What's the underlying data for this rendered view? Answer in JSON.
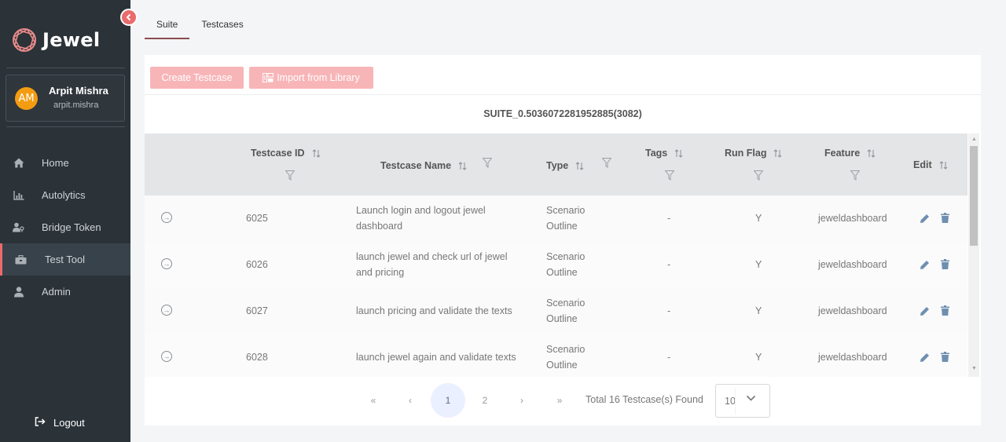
{
  "app": {
    "brand": "Jewel"
  },
  "user": {
    "initials": "AM",
    "name": "Arpit Mishra",
    "email": "arpit.mishra"
  },
  "sidebar": {
    "items": [
      {
        "label": "Home",
        "icon": "home-icon"
      },
      {
        "label": "Autolytics",
        "icon": "chart-icon"
      },
      {
        "label": "Bridge Token",
        "icon": "users-key-icon"
      },
      {
        "label": "Test Tool",
        "icon": "toolbox-icon",
        "active": true
      },
      {
        "label": "Admin",
        "icon": "user-icon"
      }
    ],
    "logout": "Logout"
  },
  "tabs": [
    {
      "label": "Suite",
      "active": true
    },
    {
      "label": "Testcases"
    }
  ],
  "toolbar": {
    "create_label": "Create Testcase",
    "import_label": "Import from Library"
  },
  "suite": {
    "title": "SUITE_0.5036072281952885(3082)"
  },
  "table": {
    "columns": [
      "Testcase ID",
      "Testcase Name",
      "Type",
      "Tags",
      "Run Flag",
      "Feature",
      "Edit"
    ],
    "rows": [
      {
        "id": "6025",
        "name": [
          "Launch login and logout jewel",
          "dashboard"
        ],
        "type": [
          "Scenario",
          "Outline"
        ],
        "tags": "-",
        "run_flag": "Y",
        "feature": "jeweldashboard"
      },
      {
        "id": "6026",
        "name": [
          "launch jewel and check url of jewel",
          "and pricing"
        ],
        "type": [
          "Scenario",
          "Outline"
        ],
        "tags": "-",
        "run_flag": "Y",
        "feature": "jeweldashboard"
      },
      {
        "id": "6027",
        "name": [
          "launch pricing and validate the texts"
        ],
        "type": [
          "Scenario",
          "Outline"
        ],
        "tags": "-",
        "run_flag": "Y",
        "feature": "jeweldashboard"
      },
      {
        "id": "6028",
        "name": [
          "launch jewel again and validate texts"
        ],
        "type": [
          "Scenario",
          "Outline"
        ],
        "tags": "-",
        "run_flag": "Y",
        "feature": "jeweldashboard"
      }
    ]
  },
  "pagination": {
    "first": "«",
    "prev": "‹",
    "pages": [
      "1",
      "2"
    ],
    "current": "1",
    "next": "›",
    "last": "»",
    "total_text": "Total 16 Testcase(s) Found",
    "rows_per_page": "10"
  },
  "colors": {
    "sidebar_bg": "#2b3238",
    "accent": "#ea6b6b",
    "button_bg": "#f8b5b8",
    "header_bg": "#e4e5e7",
    "avatar": "#f39c12"
  }
}
